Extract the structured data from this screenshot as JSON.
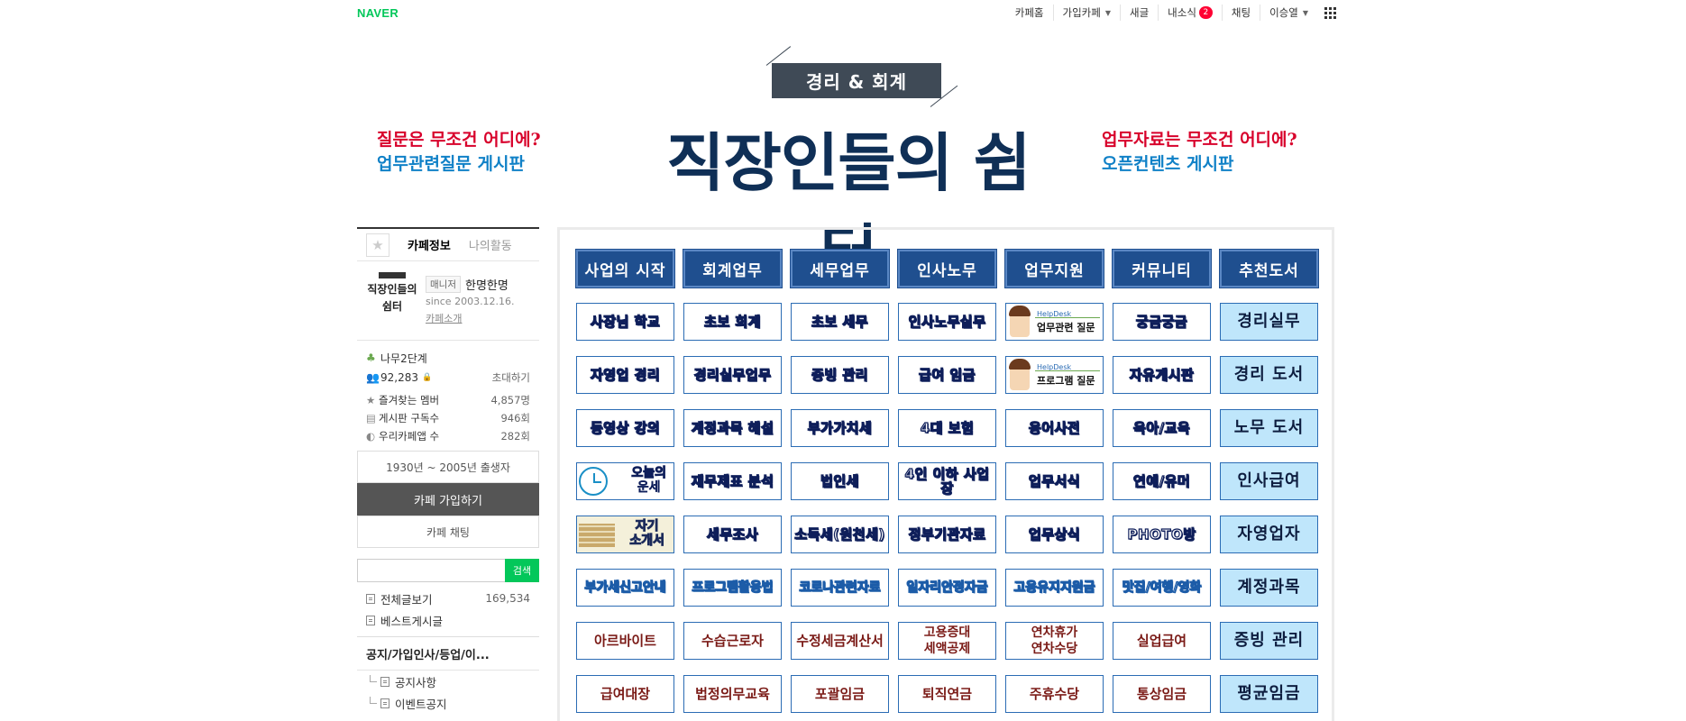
{
  "gnb": {
    "logo": "NAVER",
    "cafe_home": "카페홈",
    "joined_cafe": "가입카페",
    "new_posts": "새글",
    "my_news": "내소식",
    "my_news_count": "2",
    "chat": "채팅",
    "user": "이승열"
  },
  "banner": {
    "tag": "경리 & 회계",
    "title": "직장인들의 쉼터",
    "left_line1": "질문은 무조건 어디에?",
    "left_line2": "업무관련질문 게시판",
    "right_line1": "업무자료는 무조건 어디에?",
    "right_line2": "오픈컨텐츠 게시판"
  },
  "sidebar": {
    "tabs": [
      "카페정보",
      "나의활동"
    ],
    "cafe_name_line1": "직장인들의",
    "cafe_name_line2": "쉼터",
    "manager_badge": "매니저",
    "manager_name": "한명한명",
    "since": "since 2003.12.16.",
    "cafe_intro": "카페소개",
    "level": "나무2단계",
    "members": "92,283",
    "invite": "초대하기",
    "stats": [
      {
        "label": "즐겨찾는 멤버",
        "value": "4,857명"
      },
      {
        "label": "게시판 구독수",
        "value": "946회"
      },
      {
        "label": "우리카페앱 수",
        "value": "282회"
      }
    ],
    "birth_range": "1930년 ~ 2005년 출생자",
    "join_button": "카페 가입하기",
    "chat_button": "카페 채팅",
    "search_placeholder": "",
    "search_button": "검색",
    "all_posts": "전체글보기",
    "all_posts_count": "169,534",
    "best_board": "베스트게시글",
    "menu_group": "공지/가입인사/등업/이...",
    "submenu": [
      "공지사항",
      "이벤트공지"
    ]
  },
  "board": {
    "headers": [
      "사업의 시작",
      "회계업무",
      "세무업무",
      "인사노무",
      "업무지원",
      "커뮤니티",
      "추천도서"
    ],
    "rows": [
      [
        "사장님 학교",
        "초보 회계",
        "초보 세무",
        "인사노무실무",
        {
          "img": "helpdesk",
          "text": "업무관련 질문",
          "hd": "HelpDesk"
        },
        "궁금궁금",
        "경리실무"
      ],
      [
        "자영업 경리",
        "경리실무업무",
        "증빙 관리",
        "급여 임금",
        {
          "img": "helpdesk",
          "text": "프로그램 질문",
          "hd": "HelpDesk"
        },
        "자유게시판",
        "경리 도서"
      ],
      [
        "동영상 강의",
        "계정과목 해설",
        "부가가치세",
        "4대 보험",
        "용어사전",
        "육아/교육",
        "노무 도서"
      ],
      [
        {
          "img": "clock",
          "text1": "오늘의",
          "text2": "운세"
        },
        "재무제표 분석",
        "법인세",
        "4인 이하 사업장",
        "업무서식",
        "연예/유머",
        "인사급여"
      ],
      [
        {
          "img": "books",
          "text1": "자기",
          "text2": "소개서"
        },
        "세무조사",
        "소득세(원천세)",
        "정부기관자료",
        "업무상식",
        "PHOTO방",
        "자영업자"
      ],
      [
        "부가세신고안내",
        "프로그램활용법",
        "코로나관련자료",
        "일자리안정자금",
        "고용유지지원금",
        "맛집/여행/영화",
        "계정과목"
      ],
      [
        "아르바이트",
        "수습근로자",
        "수정세금계산서",
        "고용증대\n세액공제",
        "연차휴가\n연차수당",
        "실업급여",
        "증빙 관리"
      ],
      [
        "급여대장",
        "법정의무교육",
        "포괄임금",
        "퇴직연금",
        "주휴수당",
        "통상임금",
        "평균임금"
      ]
    ]
  },
  "colors": {
    "naver_green": "#03c75a",
    "title_navy": "#0f2f56",
    "accent_red": "#d8002b",
    "accent_blue": "#1081c7",
    "header_blue": "#1f4f8f",
    "light_cell": "#bfe6fb"
  }
}
